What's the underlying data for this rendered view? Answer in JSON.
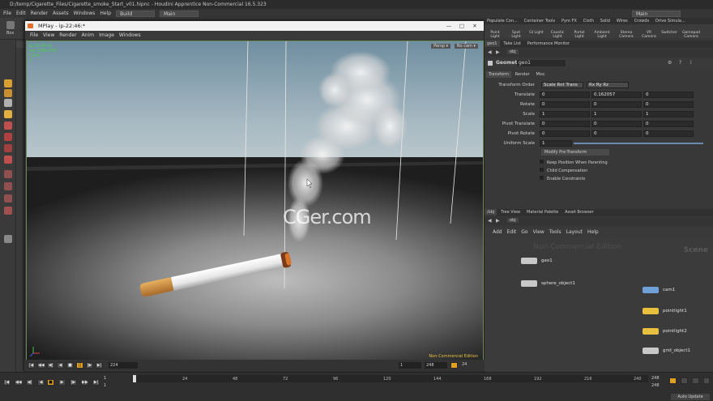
{
  "window_title": "D:/temp/Cigarette_Files/Cigarette_smoke_Start_v01.hipnc - Houdini Apprentice Non-Commercial 16.5.323",
  "main_menu": [
    "File",
    "Edit",
    "Render",
    "Assets",
    "Windows",
    "Help"
  ],
  "build_dd": "Build",
  "main_dd": "Main",
  "main_dd2": "Main",
  "shelf_tabs": [
    "Lights and...",
    "Collisions",
    "Particles",
    "Grains",
    "Rigid Bodies",
    "Particle Fluids",
    "Viscous Fluids",
    "Oceans",
    "Fluid Containers",
    "Populate Con...",
    "Container Tools",
    "Pyro FX",
    "Cloth",
    "Solid",
    "Wires",
    "Crowds",
    "Drive Simula..."
  ],
  "shelf_tools_right": [
    "Point Light",
    "Spot Light",
    "GI Light",
    "Caustic Light",
    "Portal Light",
    "Ambient Light",
    "Stereo Camera",
    "VR Camera",
    "Switcher",
    "Gamepad Camera"
  ],
  "mplay": {
    "title": "MPlay - ip-22:46:*",
    "menu": [
      "File",
      "View",
      "Render",
      "Anim",
      "Image",
      "Windows"
    ],
    "persp": "Persp ▾",
    "nocam": "No cam ▾",
    "overlay": [
      "ip 22:46:41",
      "res 1280x720",
      "f 224",
      "C"
    ],
    "watermark": "Non-Commercial Edition",
    "ticks": [
      "1",
      "24",
      "48",
      "72",
      "96",
      "120",
      "144",
      "168",
      "192",
      "216",
      "240"
    ],
    "current_frame": "224",
    "start": "1",
    "end": "248",
    "fps": "24",
    "frame_marker": "224"
  },
  "cger": "CGer.com",
  "right_top_tabs": [
    "geo1",
    "Take List",
    "Performance Monitor"
  ],
  "path": "obj",
  "geo": {
    "type": "Geometry",
    "name": "geo1"
  },
  "param_tabs": [
    "Transform",
    "Render",
    "Misc"
  ],
  "params": {
    "transform_order_label": "Transform Order",
    "transform_order": "Scale Rot Trans",
    "rot_order": "Rx Ry Rz",
    "rows": [
      {
        "label": "Translate",
        "x": "0",
        "y": "0.162057",
        "z": "0"
      },
      {
        "label": "Rotate",
        "x": "0",
        "y": "0",
        "z": "0"
      },
      {
        "label": "Scale",
        "x": "1",
        "y": "1",
        "z": "1"
      },
      {
        "label": "Pivot Translate",
        "x": "0",
        "y": "0",
        "z": "0"
      },
      {
        "label": "Pivot Rotate",
        "x": "0",
        "y": "0",
        "z": "0"
      }
    ],
    "uniform_label": "Uniform Scale",
    "uniform_value": "1",
    "modify_btn": "Modify Pre-Transform",
    "checks": [
      "Keep Position When Parenting",
      "Child Compensation",
      "Enable Constraints"
    ]
  },
  "net_tabs": [
    "/obj",
    "Tree View",
    "Material Palette",
    "Asset Browser"
  ],
  "net_menu": [
    "Add",
    "Edit",
    "Go",
    "View",
    "Tools",
    "Layout",
    "Help"
  ],
  "net_watermark": "Non-Commercial Edition",
  "net_context": "Scene",
  "nodes": [
    {
      "label": "geo1",
      "color": "#c8c8c8"
    },
    {
      "label": "sphere_object1",
      "color": "#c8c8c8"
    },
    {
      "label": "cam1",
      "color": "#6fa0d8"
    },
    {
      "label": "pointlight1",
      "color": "#e8c040"
    },
    {
      "label": "pointlight2",
      "color": "#e8c040"
    },
    {
      "label": "grid_object1",
      "color": "#c8c8c8"
    }
  ],
  "bottom": {
    "ticks": [
      "1",
      "24",
      "48",
      "72",
      "96",
      "120",
      "144",
      "168",
      "192",
      "216",
      "240"
    ],
    "frame": "1",
    "frame2": "1",
    "end": "248",
    "end2": "248",
    "auto_update": "Auto Update"
  }
}
